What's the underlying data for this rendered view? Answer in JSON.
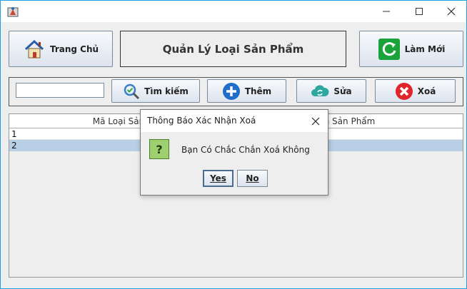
{
  "window": {
    "title": ""
  },
  "header": {
    "home_label": "Trang Chủ",
    "page_title": "Quản Lý Loại Sản Phẩm",
    "refresh_label": "Làm Mới"
  },
  "toolbar": {
    "search_value": "",
    "search_label": "Tìm kiếm",
    "add_label": "Thêm",
    "edit_label": "Sửa",
    "delete_label": "Xoá"
  },
  "table": {
    "columns": [
      "Mã Loại Sản P",
      "n Sản Phẩm"
    ],
    "rows": [
      {
        "id": "1"
      },
      {
        "id": "2"
      }
    ]
  },
  "dialog": {
    "title": "Thông Báo Xác Nhận Xoá",
    "message": "Bạn Có Chắc Chắn Xoá Không",
    "yes_label": "Yes",
    "no_label": "No"
  },
  "colors": {
    "selected_row": "#b8cfe5",
    "window_border": "#1ba1e2"
  }
}
